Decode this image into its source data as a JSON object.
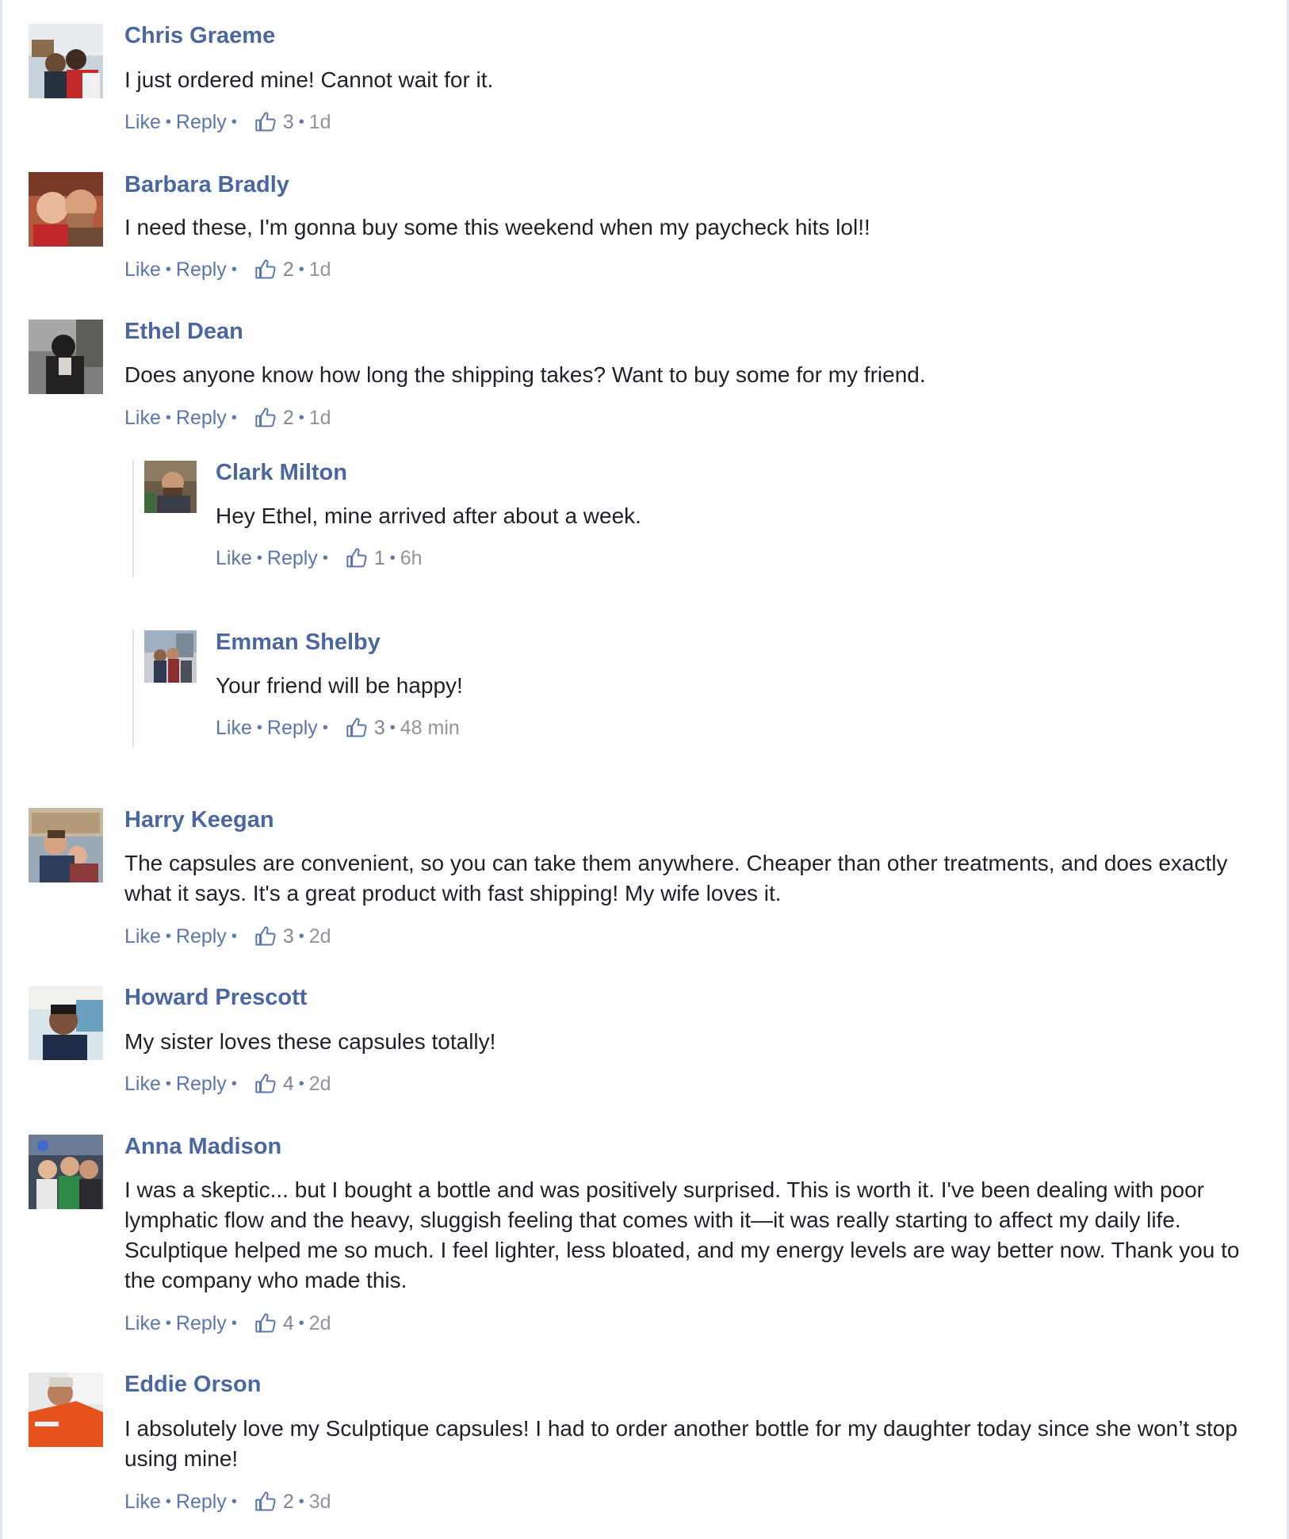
{
  "colors": {
    "author": "#4b67a1",
    "link": "#5b76ae",
    "text": "#1d2129",
    "meta": "#90949c",
    "frame": "#dfe7f3"
  },
  "icons": {
    "like": "thumbs-up-icon"
  },
  "comments": [
    {
      "author": "Chris Graeme",
      "text": "I just ordered mine! Cannot wait for it.",
      "like_label": "Like",
      "reply_label": "Reply",
      "likes": "3",
      "time": "1d"
    },
    {
      "author": "Barbara Bradly",
      "text": "I need these, I'm gonna buy some this weekend when my paycheck hits lol!!",
      "like_label": "Like",
      "reply_label": "Reply",
      "likes": "2",
      "time": "1d"
    },
    {
      "author": "Ethel Dean",
      "text": "Does anyone know how long the shipping takes? Want to buy some for my friend.",
      "like_label": "Like",
      "reply_label": "Reply",
      "likes": "2",
      "time": "1d"
    },
    {
      "author": "Clark Milton",
      "text": "Hey Ethel, mine arrived after about a week.",
      "like_label": "Like",
      "reply_label": "Reply",
      "likes": "1",
      "time": "6h"
    },
    {
      "author": "Emman Shelby",
      "text": "Your friend will be happy!",
      "like_label": "Like",
      "reply_label": "Reply",
      "likes": "3",
      "time": "48 min"
    },
    {
      "author": "Harry Keegan",
      "text": "The capsules are convenient, so you can take them anywhere. Cheaper than other treatments, and does exactly what it says. It's a great product with fast shipping! My wife loves it.",
      "like_label": "Like",
      "reply_label": "Reply",
      "likes": "3",
      "time": "2d"
    },
    {
      "author": "Howard Prescott",
      "text": "My sister loves these capsules totally!",
      "like_label": "Like",
      "reply_label": "Reply",
      "likes": "4",
      "time": "2d"
    },
    {
      "author": "Anna Madison",
      "text": "I was a skeptic... but I bought a bottle and was positively surprised. This is worth it. I've been dealing with poor lymphatic flow and the heavy, sluggish feeling that comes with it—it was really starting to affect my daily life. Sculptique helped me so much. I feel lighter, less bloated, and my energy levels are way better now. Thank you to the company who made this.",
      "like_label": "Like",
      "reply_label": "Reply",
      "likes": "4",
      "time": "2d"
    },
    {
      "author": "Eddie Orson",
      "text": "I absolutely love my Sculptique capsules! I had to order another bottle for my daughter today since she won’t stop using mine!",
      "like_label": "Like",
      "reply_label": "Reply",
      "likes": "2",
      "time": "3d"
    }
  ]
}
